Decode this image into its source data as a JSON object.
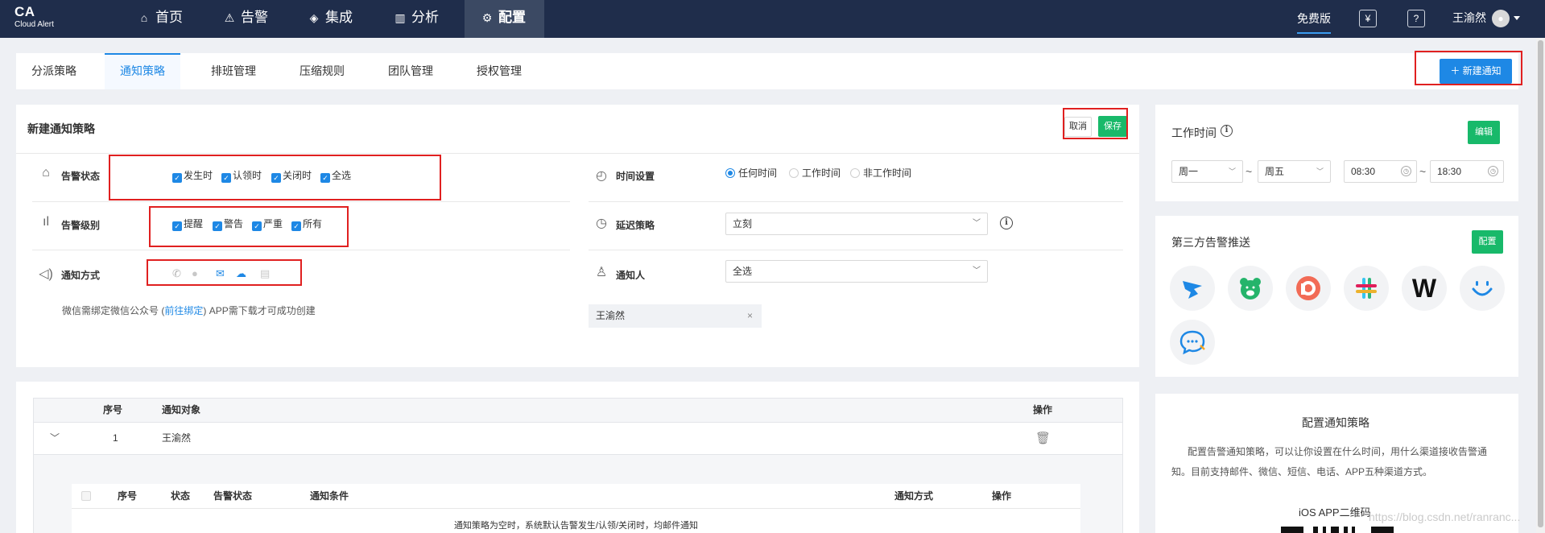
{
  "app": {
    "logo_main": "CA",
    "logo_sub": "Cloud Alert"
  },
  "topnav": {
    "items": [
      {
        "label": "首页",
        "icon": "home-icon"
      },
      {
        "label": "告警",
        "icon": "siren-icon"
      },
      {
        "label": "集成",
        "icon": "layers-icon"
      },
      {
        "label": "分析",
        "icon": "chart-icon"
      },
      {
        "label": "配置",
        "icon": "gear-icon",
        "active": true
      }
    ],
    "free_label": "免费版",
    "user_name": "王渝然"
  },
  "tabs": [
    {
      "label": "分派策略"
    },
    {
      "label": "通知策略",
      "active": true
    },
    {
      "label": "排班管理"
    },
    {
      "label": "压缩规则"
    },
    {
      "label": "团队管理"
    },
    {
      "label": "授权管理"
    }
  ],
  "new_button": "＋ 新建通知",
  "form": {
    "title": "新建通知策略",
    "cancel_label": "取消",
    "save_label": "保存",
    "alert_status": {
      "label": "告警状态",
      "options": [
        "发生时",
        "认领时",
        "关闭时",
        "全选"
      ]
    },
    "alert_level": {
      "label": "告警级别",
      "options": [
        "提醒",
        "警告",
        "严重",
        "所有"
      ]
    },
    "notify_method": {
      "label": "通知方式",
      "icons": [
        "phone-icon",
        "sms-icon",
        "email-icon",
        "wechat-icon",
        "app-icon"
      ]
    },
    "hint_prefix": "微信需绑定微信公众号 (",
    "hint_link": "前往绑定",
    "hint_suffix": ") APP需下载才可成功创建",
    "time_setting": {
      "label": "时间设置",
      "options": [
        "任何时间",
        "工作时间",
        "非工作时间"
      ],
      "selected": "任何时间"
    },
    "delay_policy": {
      "label": "延迟策略",
      "value": "立刻"
    },
    "notify_person": {
      "label": "通知人",
      "value": "全选",
      "tag": "王渝然",
      "tag_close": "×"
    }
  },
  "table": {
    "headers": [
      "序号",
      "通知对象",
      "操作"
    ],
    "rows": [
      {
        "index": "1",
        "target": "王渝然"
      }
    ],
    "sub_headers": [
      "序号",
      "状态",
      "告警状态",
      "通知条件",
      "通知方式",
      "操作"
    ],
    "sub_empty": "通知策略为空时，系统默认告警发生/认领/关闭时，均邮件通知"
  },
  "work_time": {
    "title": "工作时间",
    "edit_label": "编辑",
    "day_from": "周一",
    "day_to": "周五",
    "time_from": "08:30",
    "time_to": "18:30",
    "tilde": "~"
  },
  "third_party": {
    "title": "第三方告警推送",
    "config_label": "配置",
    "apps": [
      "dingtalk-icon",
      "bear-icon",
      "pagerduty-icon",
      "slack-icon",
      "w-icon",
      "smile-icon",
      "chat-icon"
    ],
    "w_letter": "W"
  },
  "config_info": {
    "title": "配置通知策略",
    "desc": "配置告警通知策略，可以让你设置在什么时间，用什么渠道接收告警通知。目前支持邮件、微信、短信、电话、APP五种渠道方式。",
    "ios_title": "iOS APP二维码"
  },
  "watermark": "https://blog.csdn.net/ranranc...",
  "colors": {
    "nav_bg": "#1f2d4b",
    "primary": "#1e88e5",
    "green": "#18b96a",
    "highlight": "#e02020"
  }
}
